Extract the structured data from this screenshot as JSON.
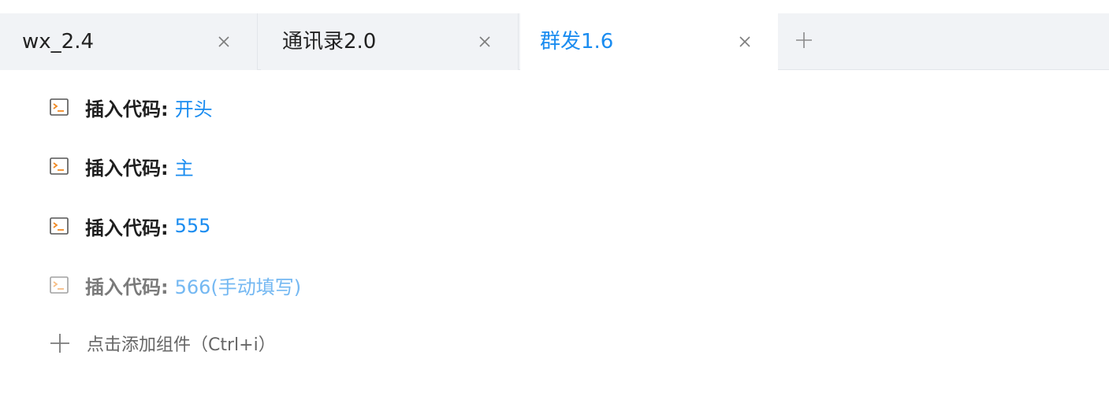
{
  "tabs": [
    {
      "label": "wx_2.4",
      "active": false
    },
    {
      "label": "通讯录2.0",
      "active": false
    },
    {
      "label": "群发1.6",
      "active": true
    }
  ],
  "rows": [
    {
      "label": "插入代码:",
      "value": "开头",
      "disabled": false
    },
    {
      "label": "插入代码:",
      "value": "主",
      "disabled": false
    },
    {
      "label": "插入代码:",
      "value": "555",
      "disabled": false
    },
    {
      "label": "插入代码:",
      "value": "566(手动填写)",
      "disabled": true
    }
  ],
  "add_component": {
    "label": "点击添加组件（Ctrl+i）"
  },
  "colors": {
    "accent": "#1a8cf0",
    "accent_disabled": "#74b8f2",
    "tabbar_bg": "#f1f3f6",
    "icon_orange": "#f08a24"
  },
  "icons": {
    "tab_close": "close-icon",
    "add_tab": "plus-icon",
    "row": "terminal-code-icon",
    "add_component": "plus-icon"
  }
}
